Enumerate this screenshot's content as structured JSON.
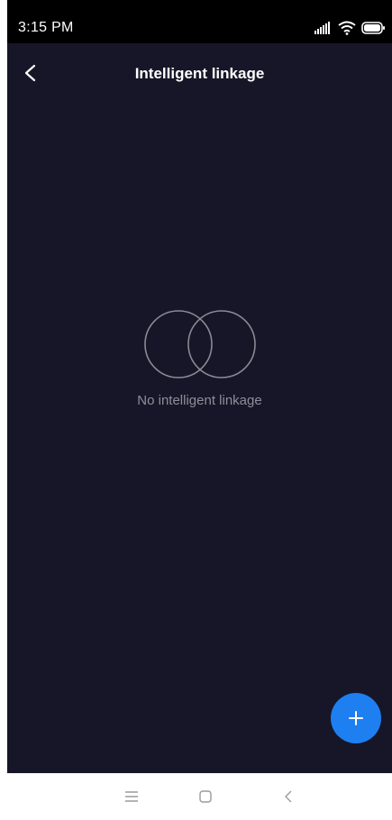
{
  "status_bar": {
    "time": "3:15 PM",
    "icons": [
      "signal-icon",
      "wifi-icon",
      "battery-icon"
    ]
  },
  "header": {
    "title": "Intelligent linkage",
    "back_icon": "chevron-left-icon"
  },
  "empty_state": {
    "icon": "linked-circles-icon",
    "message": "No intelligent linkage"
  },
  "fab": {
    "icon": "plus-icon"
  },
  "nav_bar": {
    "items": [
      "menu-icon",
      "home-icon",
      "back-icon"
    ]
  },
  "colors": {
    "background": "#161628",
    "accent": "#1e7ff0",
    "muted_text": "#8e8e9a"
  }
}
